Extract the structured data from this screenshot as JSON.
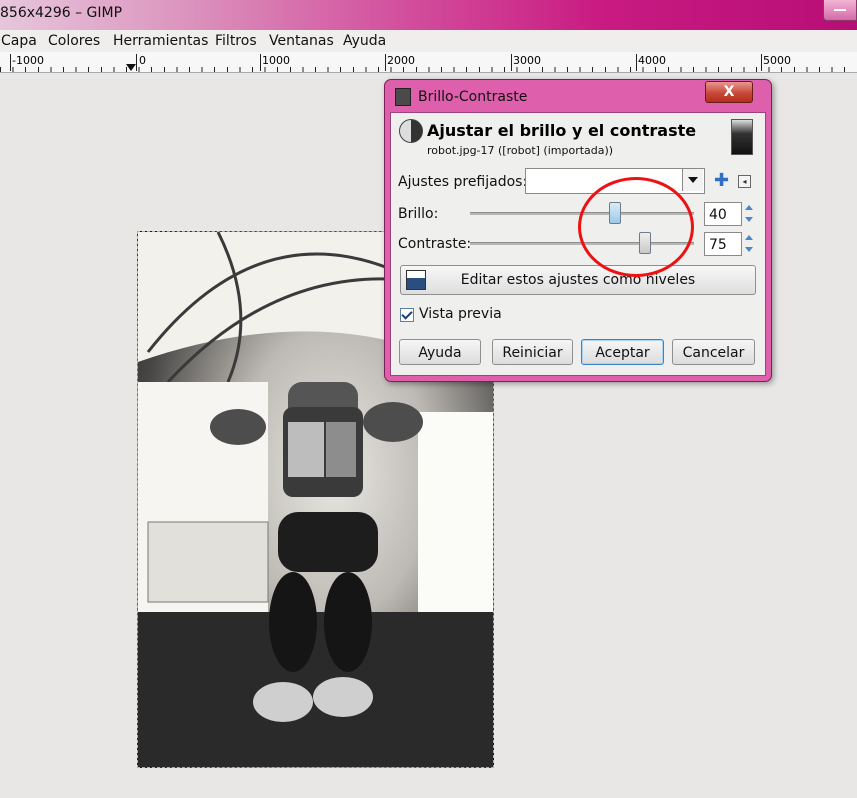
{
  "window": {
    "title": "856x4296 – GIMP"
  },
  "menu": [
    "Capa",
    "Colores",
    "Herramientas",
    "Filtros",
    "Ventanas",
    "Ayuda"
  ],
  "ruler": {
    "labels": [
      "-1000",
      "0",
      "1000",
      "2000",
      "3000",
      "4000",
      "5000"
    ]
  },
  "dialog": {
    "title": "Brillo-Contraste",
    "close_label": "X",
    "header": {
      "title": "Ajustar el brillo y el contraste",
      "subtitle": "robot.jpg-17 ([robot] (importada))"
    },
    "presets_label": "Ajustes prefijados:",
    "presets_value": "",
    "brillo": {
      "label": "Brillo:",
      "value": "40",
      "min": -127,
      "max": 127
    },
    "contraste": {
      "label": "Contraste:",
      "value": "75",
      "min": -127,
      "max": 127
    },
    "levels_button": "Editar estos ajustes como niveles",
    "preview_label": "Vista previa",
    "preview_checked": true,
    "buttons": {
      "help": "Ayuda",
      "reset": "Reiniciar",
      "ok": "Aceptar",
      "cancel": "Cancelar"
    }
  },
  "icons": [
    "window-control-icon",
    "dialog-app-icon",
    "brightness-contrast-icon",
    "image-thumbnail-icon",
    "dropdown-arrow-icon",
    "add-preset-icon",
    "preset-menu-icon",
    "levels-icon",
    "checkbox-check-icon",
    "spin-up-icon",
    "spin-down-icon"
  ],
  "colors": {
    "title_accent": "#c91b82",
    "dialog_frame": "#de5fab",
    "annotation_circle": "#e11111",
    "spin_arrows": "#4a86c8"
  }
}
